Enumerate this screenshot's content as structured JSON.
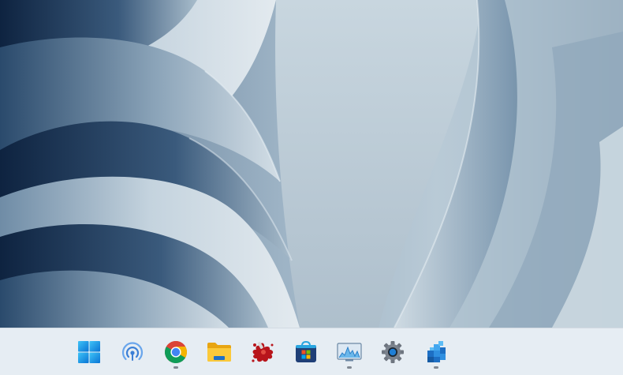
{
  "desktop": {
    "wallpaper": "windows-11-bloom-light-blue"
  },
  "taskbar": {
    "items": [
      {
        "name": "start",
        "icon": "windows-start-icon",
        "running": false
      },
      {
        "name": "wireless-display",
        "icon": "wireless-signal-icon",
        "running": false
      },
      {
        "name": "chrome",
        "icon": "chrome-icon",
        "running": true
      },
      {
        "name": "file-explorer",
        "icon": "folder-icon",
        "running": false
      },
      {
        "name": "paint",
        "icon": "paint-splat-icon",
        "running": false
      },
      {
        "name": "microsoft-store",
        "icon": "store-bag-icon",
        "running": false
      },
      {
        "name": "performance-monitor",
        "icon": "monitor-graph-icon",
        "running": true
      },
      {
        "name": "settings",
        "icon": "gear-icon",
        "running": false
      },
      {
        "name": "app-blocks",
        "icon": "blue-cubes-icon",
        "running": true
      }
    ]
  },
  "colors": {
    "accent": "#0a84d8",
    "taskbar": "#e8eef4",
    "running_indicator": "#808892"
  }
}
